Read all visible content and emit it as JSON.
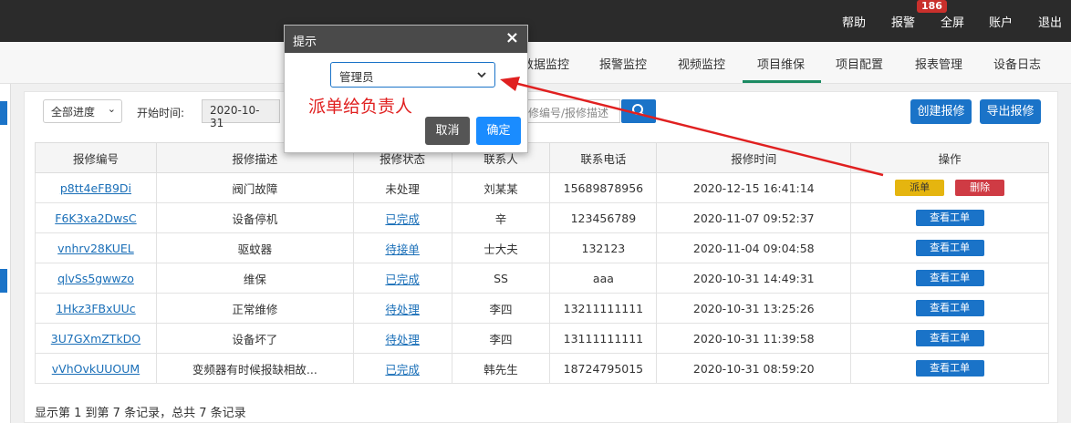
{
  "topbar": {
    "links": [
      "帮助",
      "报警",
      "全屏",
      "账户",
      "退出"
    ],
    "alarm_count": "186"
  },
  "nav": {
    "items": [
      "数据监控",
      "报警监控",
      "视频监控",
      "项目维保",
      "项目配置",
      "报表管理",
      "设备日志"
    ],
    "active": "项目维保"
  },
  "filters": {
    "progress_select": "全部进度",
    "start_label": "开始时间:",
    "start_date": "2020-10-31",
    "search_placeholder": "报修编号/报修描述"
  },
  "actions": {
    "create": "创建报修",
    "export": "导出报修"
  },
  "table": {
    "headers": [
      "报修编号",
      "报修描述",
      "报修状态",
      "联系人",
      "联系电话",
      "报修时间",
      "操作"
    ],
    "rows": [
      {
        "id": "p8tt4eFB9Di",
        "desc": "阀门故障",
        "status": "未处理",
        "contact": "刘某某",
        "phone": "15689878956",
        "time": "2020-12-15 16:41:14",
        "op": [
          "派单",
          "删除"
        ]
      },
      {
        "id": "F6K3xa2DwsC",
        "desc": "设备停机",
        "status": "已完成",
        "contact": "辛",
        "phone": "123456789",
        "time": "2020-11-07 09:52:37",
        "op": [
          "查看工单"
        ]
      },
      {
        "id": "vnhrv28KUEL",
        "desc": "驱蚊器",
        "status": "待接单",
        "contact": "士大夫",
        "phone": "132123",
        "time": "2020-11-04 09:04:58",
        "op": [
          "查看工单"
        ]
      },
      {
        "id": "qlvSs5gwwzo",
        "desc": "维保",
        "status": "已完成",
        "contact": "SS",
        "phone": "aaa",
        "time": "2020-10-31 14:49:31",
        "op": [
          "查看工单"
        ]
      },
      {
        "id": "1Hkz3FBxUUc",
        "desc": "正常维修",
        "status": "待处理",
        "contact": "李四",
        "phone": "13211111111",
        "time": "2020-10-31 13:25:26",
        "op": [
          "查看工单"
        ]
      },
      {
        "id": "3U7GXmZTkDO",
        "desc": "设备坏了",
        "status": "待处理",
        "contact": "李四",
        "phone": "13111111111",
        "time": "2020-10-31 11:39:58",
        "op": [
          "查看工单"
        ]
      },
      {
        "id": "vVhOvkUUOUM",
        "desc": "变频器有时候报缺相故...",
        "status": "已完成",
        "contact": "韩先生",
        "phone": "18724795015",
        "time": "2020-10-31 08:59:20",
        "op": [
          "查看工单"
        ]
      }
    ]
  },
  "footer": {
    "text": "显示第 1 到第 7 条记录，总共 7 条记录"
  },
  "modal": {
    "title": "提示",
    "close": "×",
    "select_value": "管理员",
    "cancel": "取消",
    "confirm": "确定"
  },
  "annotation": {
    "text": "派单给负责人",
    "color": "#e02020"
  },
  "colors": {
    "primary": "#1a73c8",
    "dispatch": "#e5b50f",
    "delete": "#cf3b44",
    "topbar": "#2b2b2b",
    "modal_cancel": "#555555",
    "modal_confirm": "#1a8cff"
  }
}
